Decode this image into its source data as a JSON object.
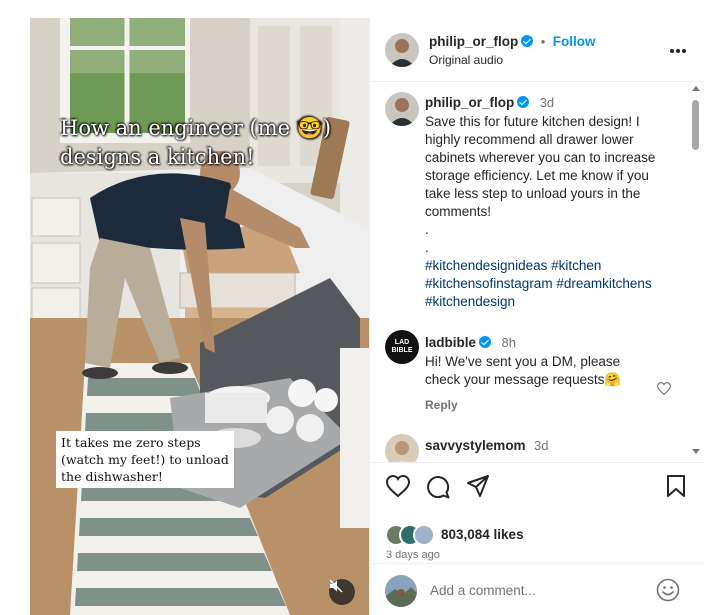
{
  "post": {
    "username": "philip_or_flop",
    "audio": "Original audio",
    "follow_label": "Follow",
    "dot": "•",
    "more_label": "•••"
  },
  "video": {
    "overlay_title": "How an engineer (me 🤓) designs a kitchen!",
    "caption_box": "It takes me zero steps (watch my feet!) to unload the dishwasher!",
    "muted": true
  },
  "caption": {
    "username": "philip_or_flop",
    "age": "3d",
    "text_lines": [
      "Save this for future kitchen design! I",
      "highly recommend all drawer lower",
      "cabinets wherever you can to increase",
      "storage efficiency. Let me know if you",
      "take less step to unload yours in the",
      "comments!",
      ".",
      "."
    ],
    "hashtag_lines": [
      "#kitchendesignideas #kitchen",
      "#kitchensofinstagram #dreamkitchens",
      "#kitchendesign"
    ]
  },
  "comments": [
    {
      "username": "ladbible",
      "age": "8h",
      "avatar_text": "LAD BIBLE",
      "text_lines": [
        "Hi! We've sent you a DM, please",
        "check your message requests🤗"
      ],
      "reply_label": "Reply"
    },
    {
      "username": "savvystylemom",
      "age": "3d"
    }
  ],
  "engagement": {
    "likes": "803,084 likes",
    "time_ago": "3 days ago"
  },
  "comment_input": {
    "placeholder": "Add a comment..."
  },
  "colors": {
    "link_blue": "#0095f6",
    "hashtag_blue": "#00376b",
    "text": "#262626",
    "muted": "#737373"
  }
}
